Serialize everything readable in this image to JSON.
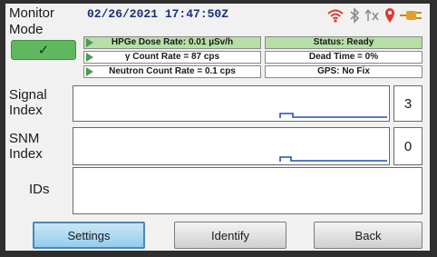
{
  "mode": {
    "title": "Monitor Mode",
    "status_ok": "✓"
  },
  "datetime": "02/26/2021 17:47:50Z",
  "icons": [
    "wifi-icon",
    "bluetooth-icon",
    "antenna-off-icon",
    "location-pin-icon",
    "power-plug-icon"
  ],
  "info": {
    "dose_rate": "HPGe Dose Rate: 0.01  µSv/h",
    "gamma_rate": "γ Count Rate = 87 cps",
    "neutron_rate": "Neutron Count Rate = 0.1 cps",
    "status": "Status: Ready",
    "dead_time": "Dead Time = 0%",
    "gps": "GPS: No Fix"
  },
  "signal_index": {
    "label": "Signal Index",
    "value": "3"
  },
  "snm_index": {
    "label": "SNM Index",
    "value": "0"
  },
  "ids": {
    "label": "IDs",
    "value": ""
  },
  "buttons": {
    "settings": "Settings",
    "identify": "Identify",
    "back": "Back"
  },
  "colors": {
    "accent_green": "#5fb85f",
    "trace_blue": "#1f4fb5",
    "date_blue": "#1b2f7a",
    "active_button": "#93cdec"
  }
}
